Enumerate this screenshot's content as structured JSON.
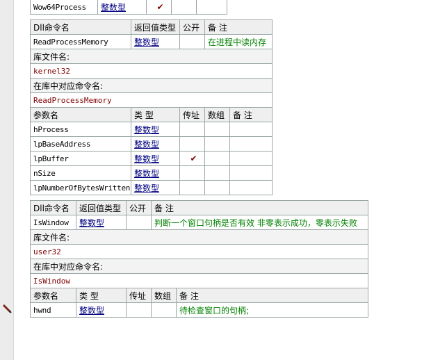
{
  "top_fragment": {
    "name": "Wow64Process",
    "type": "整数型",
    "byref": true
  },
  "headers": {
    "dll_cmd": "Dll命令名",
    "return_type": "返回值类型",
    "public": "公开",
    "remark": "备 注",
    "lib_file": "库文件名:",
    "lib_cmd": "在库中对应命令名:",
    "param_name": "参数名",
    "type": "类 型",
    "byref": "传址",
    "array": "数组"
  },
  "check_glyph": "✔",
  "commands": [
    {
      "name": "ReadProcessMemory",
      "return_type": "整数型",
      "remark": "在进程中读内存",
      "lib_file": "kernel32",
      "lib_cmd": "ReadProcessMemory",
      "params": [
        {
          "name": "hProcess",
          "type": "整数型",
          "byref": false,
          "remark": ""
        },
        {
          "name": "lpBaseAddress",
          "type": "整数型",
          "byref": false,
          "remark": ""
        },
        {
          "name": "lpBuffer",
          "type": "整数型",
          "byref": true,
          "remark": ""
        },
        {
          "name": "nSize",
          "type": "整数型",
          "byref": false,
          "remark": ""
        },
        {
          "name": "lpNumberOfBytesWritten",
          "type": "整数型",
          "byref": false,
          "remark": ""
        }
      ]
    },
    {
      "name": "IsWindow",
      "return_type": "整数型",
      "remark": "判断一个窗口句柄是否有效  非零表示成功，零表示失败",
      "lib_file": "user32",
      "lib_cmd": "IsWindow",
      "params": [
        {
          "name": "hwnd",
          "type": "整数型",
          "byref": false,
          "remark": "待检查窗口的句柄;"
        }
      ]
    }
  ]
}
